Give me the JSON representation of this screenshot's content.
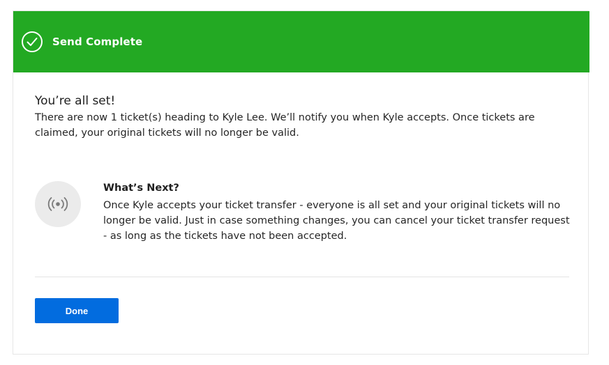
{
  "banner": {
    "icon": "check-circle-icon",
    "title": "Send Complete",
    "background_color": "#23a923"
  },
  "confirmation": {
    "heading": "You’re all set!",
    "message": "There are now 1 ticket(s) heading to Kyle Lee. We’ll notify you when Kyle accepts. Once tickets are claimed, your original tickets will no longer be valid."
  },
  "whats_next": {
    "icon": "broadcast-icon",
    "title": "What’s Next?",
    "body": "Once Kyle accepts your ticket transfer - everyone is all set and your original tickets will no longer be valid. Just in case something changes, you can cancel your ticket transfer request - as long as the tickets have not been accepted."
  },
  "actions": {
    "done_label": "Done",
    "accent_color": "#026cdf"
  }
}
